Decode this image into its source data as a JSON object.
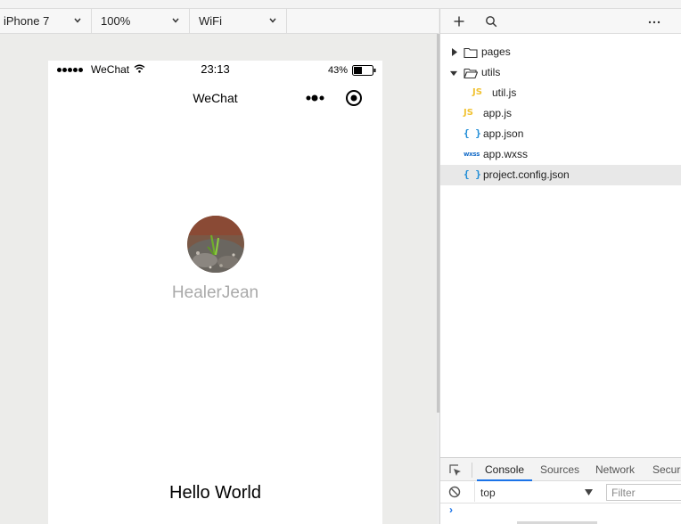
{
  "device_toolbar": {
    "device": "iPhone 7",
    "zoom": "100%",
    "network": "WiFi"
  },
  "phone": {
    "status": {
      "carrier": "WeChat",
      "time": "23:13",
      "battery": "43%"
    },
    "navbar": {
      "title": "WeChat"
    },
    "profile": {
      "nickname": "HealerJean"
    },
    "motto": "Hello World"
  },
  "file_tree": {
    "items": [
      {
        "label": "pages",
        "kind": "folder",
        "expanded": false
      },
      {
        "label": "utils",
        "kind": "folder",
        "expanded": true
      },
      {
        "label": "util.js",
        "kind": "js",
        "badge": "JS"
      },
      {
        "label": "app.js",
        "kind": "js",
        "badge": "JS"
      },
      {
        "label": "app.json",
        "kind": "json",
        "badge": "{ }"
      },
      {
        "label": "app.wxss",
        "kind": "wxss",
        "badge": "wxss"
      },
      {
        "label": "project.config.json",
        "kind": "json",
        "badge": "{ }",
        "selected": true
      }
    ]
  },
  "devtools": {
    "tabs": [
      "Console",
      "Sources",
      "Network",
      "Securi"
    ],
    "active_tab": "Console",
    "context": "top",
    "filter_placeholder": "Filter",
    "prompt": "›"
  },
  "colors": {
    "accent": "#1a73e8",
    "js_badge": "#f1c232",
    "json_badge": "#1a8ad6",
    "nickname": "#aaaaaa"
  }
}
